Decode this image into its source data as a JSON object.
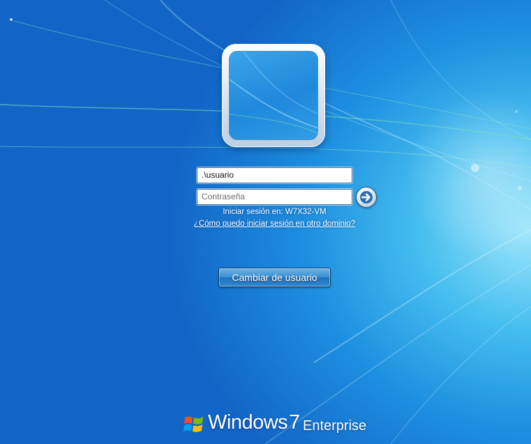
{
  "login": {
    "username_value": ".\\usuario",
    "password_placeholder": "Contraseña",
    "signin_info": "Iniciar sesión en: W7X32-VM",
    "domain_help_link": "¿Cómo puedo iniciar sesión en otro dominio?",
    "switch_user_label": "Cambiar de usuario",
    "submit_icon": "arrow-right-icon"
  },
  "branding": {
    "windows": "Windows",
    "version": "7",
    "edition": "Enterprise",
    "logo_icon": "windows-flag-icon"
  },
  "colors": {
    "background_dark": "#1265c6",
    "background_light": "#9fe6fb",
    "flag_red": "#f25022",
    "flag_green": "#7fba00",
    "flag_blue": "#00a4ef",
    "flag_yellow": "#ffb900"
  }
}
